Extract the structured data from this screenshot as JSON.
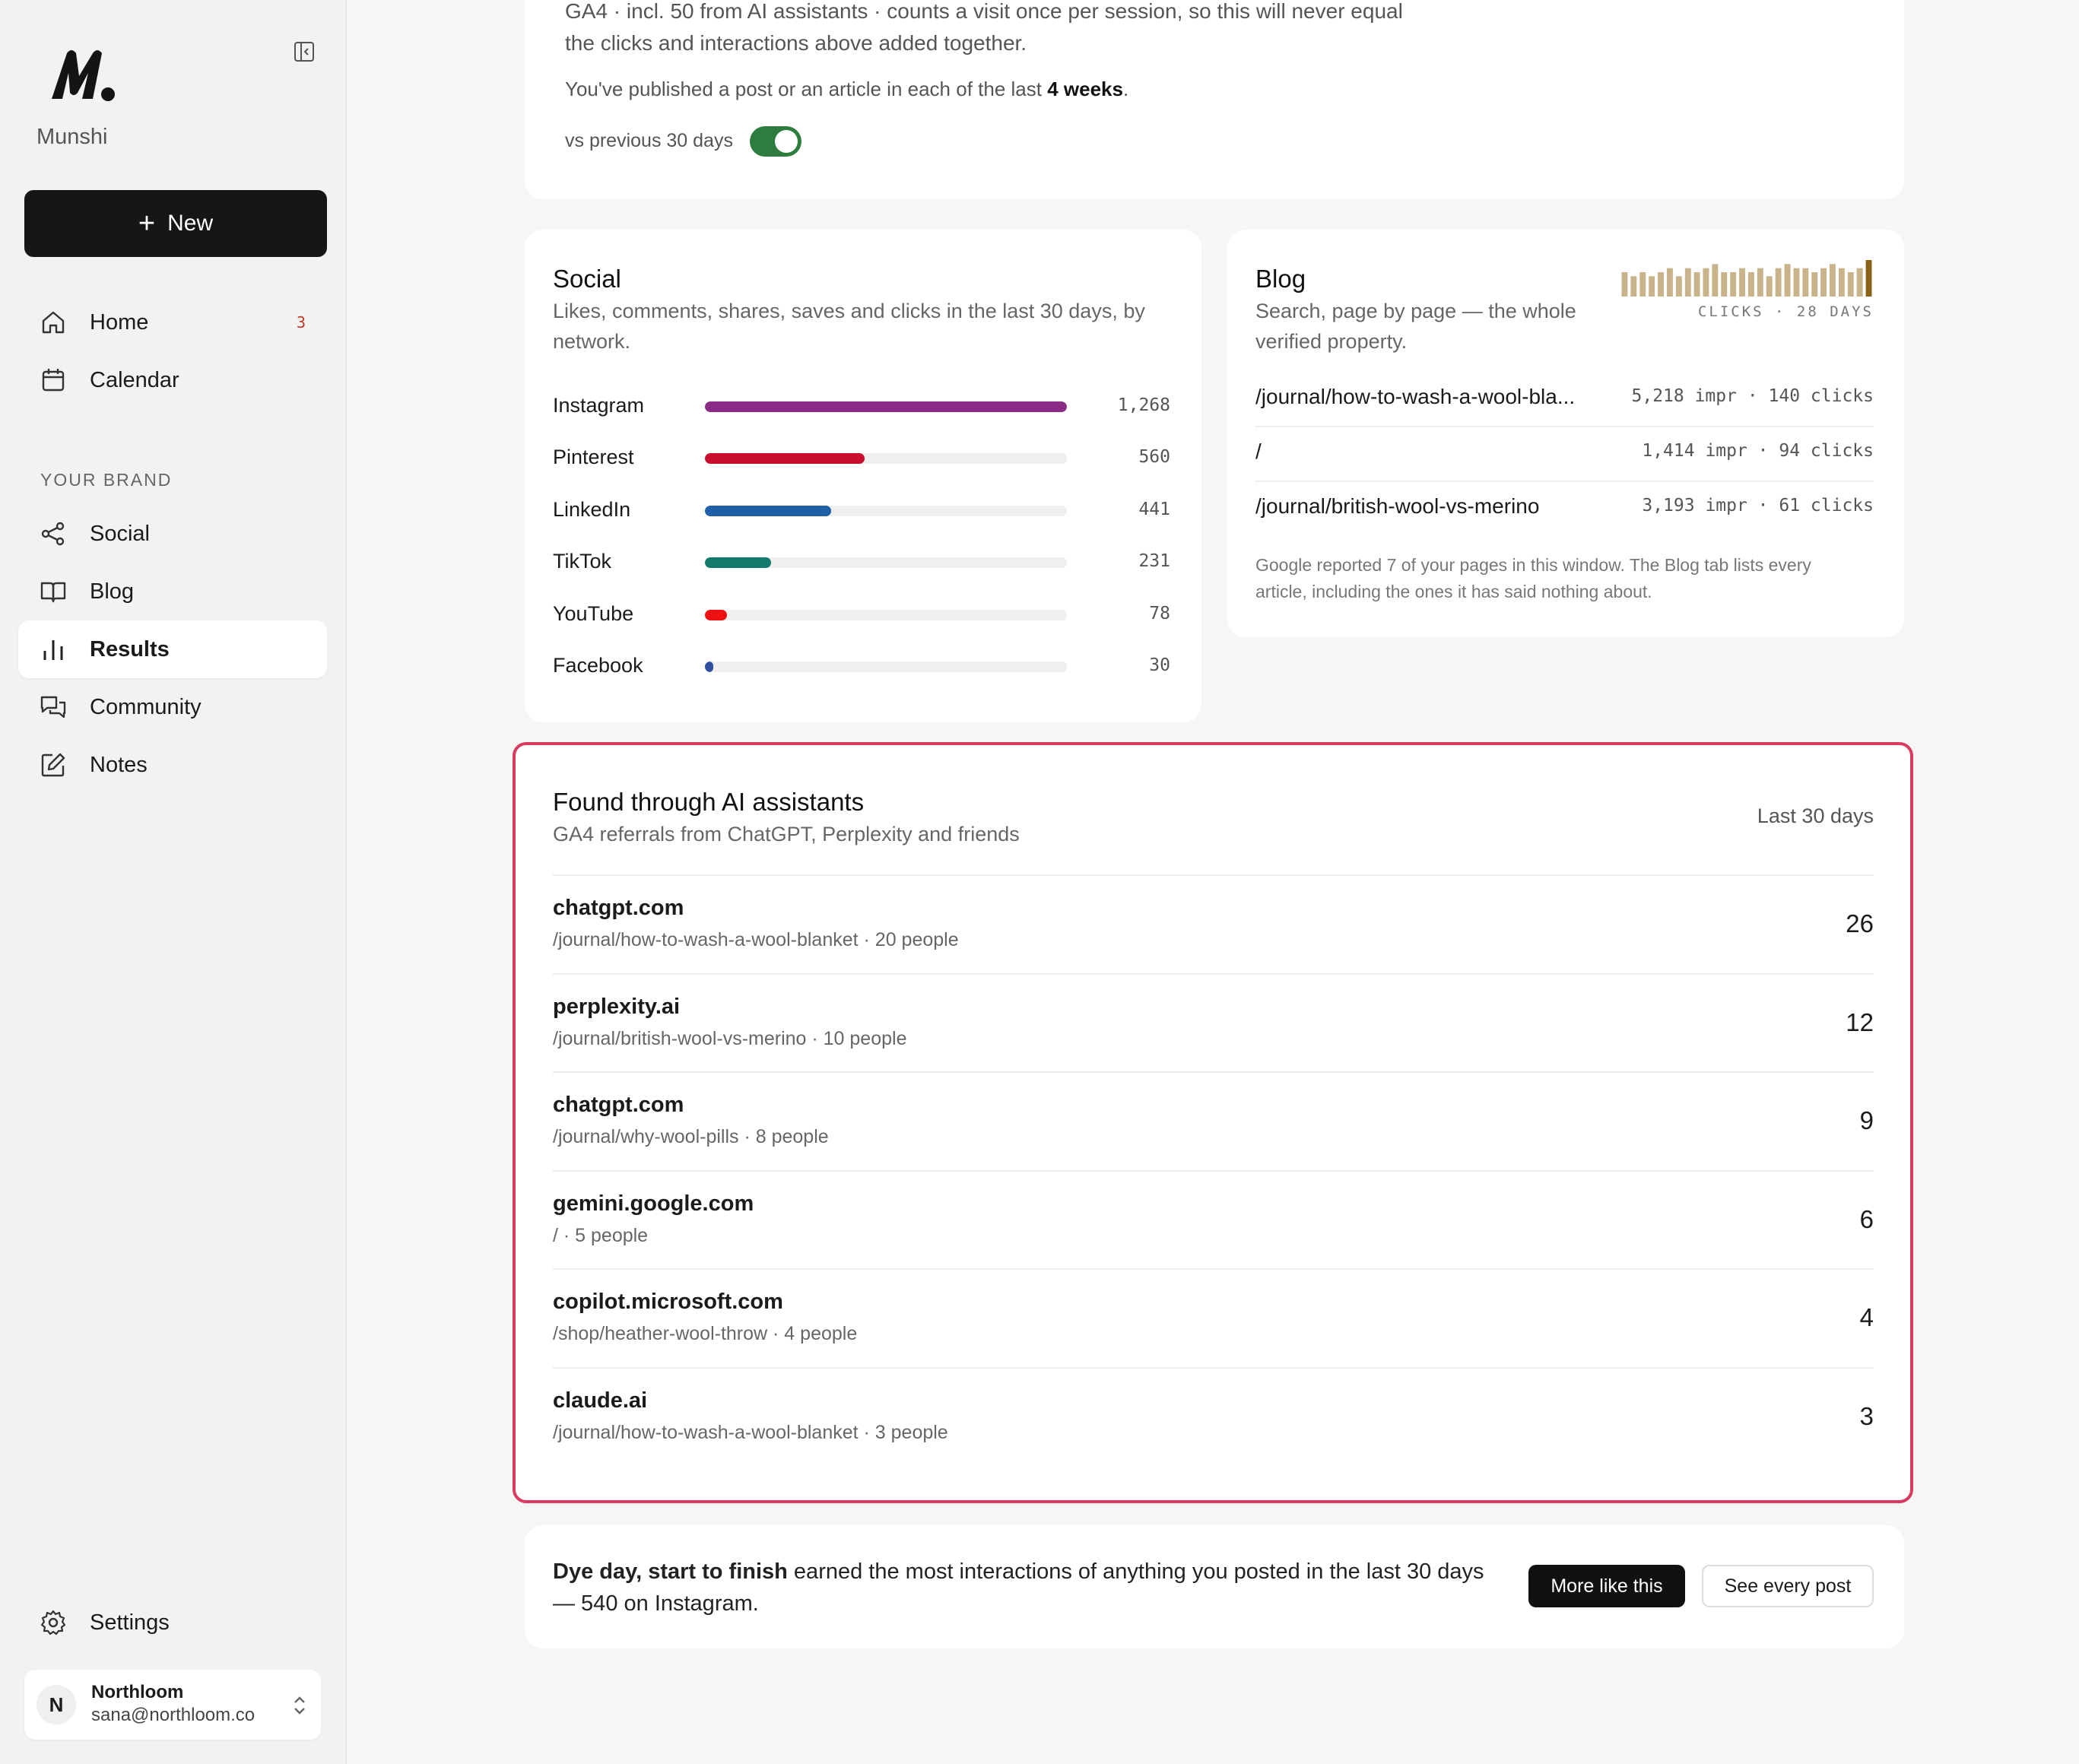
{
  "sidebar": {
    "brand_name": "Munshi",
    "new_button": "New",
    "nav": [
      {
        "label": "Home",
        "badge": "3",
        "icon": "home-icon"
      },
      {
        "label": "Calendar",
        "icon": "calendar-icon"
      }
    ],
    "section_label": "YOUR BRAND",
    "brand_nav": [
      {
        "label": "Social",
        "icon": "share-icon"
      },
      {
        "label": "Blog",
        "icon": "book-icon"
      },
      {
        "label": "Results",
        "icon": "bar-chart-icon",
        "active": true
      },
      {
        "label": "Community",
        "icon": "chat-icon"
      },
      {
        "label": "Notes",
        "icon": "edit-icon"
      }
    ],
    "settings": "Settings",
    "user": {
      "initial": "N",
      "name": "Northloom",
      "email": "sana@northloom.co"
    }
  },
  "summary": {
    "line1": "GA4 · incl. 50 from AI assistants · counts a visit once per session, so this will never equal",
    "line2": "the clicks and interactions above added together.",
    "published_prefix": "You've published a post or an article in each of the last ",
    "published_bold": "4 weeks",
    "published_suffix": ".",
    "compare_label": "vs previous 30 days",
    "compare_on": true
  },
  "social": {
    "title": "Social",
    "subtitle_1": "Likes, comments, shares, saves and clicks in the last 30 days, by",
    "subtitle_2": "network.",
    "max": 1268,
    "rows": [
      {
        "label": "Instagram",
        "value": 1268,
        "display": "1,268",
        "color": "#8b2d86"
      },
      {
        "label": "Pinterest",
        "value": 560,
        "display": "560",
        "color": "#c8102e"
      },
      {
        "label": "LinkedIn",
        "value": 441,
        "display": "441",
        "color": "#1f5fa8"
      },
      {
        "label": "TikTok",
        "value": 231,
        "display": "231",
        "color": "#137a6e"
      },
      {
        "label": "YouTube",
        "value": 78,
        "display": "78",
        "color": "#ee1111"
      },
      {
        "label": "Facebook",
        "value": 30,
        "display": "30",
        "color": "#2f4fa0"
      }
    ]
  },
  "blog": {
    "title": "Blog",
    "subtitle_1": "Search, page by page — the whole",
    "subtitle_2": "verified property.",
    "spark_caption": "CLICKS · 28 DAYS",
    "spark_color": "#c9b38a",
    "spark_last_color": "#8a6416",
    "spark_values": [
      6,
      5,
      6,
      5,
      6,
      7,
      5,
      7,
      6,
      7,
      8,
      6,
      6,
      7,
      6,
      7,
      5,
      7,
      8,
      7,
      7,
      6,
      7,
      8,
      7,
      6,
      7,
      9
    ],
    "rows": [
      {
        "path": "/journal/how-to-wash-a-wool-bla...",
        "stat": "5,218 impr · 140 clicks"
      },
      {
        "path": "/",
        "stat": "1,414 impr · 94 clicks"
      },
      {
        "path": "/journal/british-wool-vs-merino",
        "stat": "3,193 impr · 61 clicks"
      }
    ],
    "footnote_1": "Google reported 7 of your pages in this window. The Blog tab lists every",
    "footnote_2": "article, including the ones it has said nothing about."
  },
  "ai": {
    "title": "Found through AI assistants",
    "subtitle": "GA4 referrals from ChatGPT, Perplexity and friends",
    "period": "Last 30 days",
    "rows": [
      {
        "domain": "chatgpt.com",
        "meta": "/journal/how-to-wash-a-wool-blanket · 20 people",
        "count": "26"
      },
      {
        "domain": "perplexity.ai",
        "meta": "/journal/british-wool-vs-merino · 10 people",
        "count": "12"
      },
      {
        "domain": "chatgpt.com",
        "meta": "/journal/why-wool-pills · 8 people",
        "count": "9"
      },
      {
        "domain": "gemini.google.com",
        "meta": "/ · 5 people",
        "count": "6"
      },
      {
        "domain": "copilot.microsoft.com",
        "meta": "/shop/heather-wool-throw · 4 people",
        "count": "4"
      },
      {
        "domain": "claude.ai",
        "meta": "/journal/how-to-wash-a-wool-blanket · 3 people",
        "count": "3"
      }
    ]
  },
  "highlight": {
    "bold": "Dye day, start to finish",
    "text_1": " earned the most interactions of anything you posted in the last 30 days",
    "text_2": "— 540 on Instagram.",
    "primary_button": "More like this",
    "secondary_button": "See every post"
  }
}
